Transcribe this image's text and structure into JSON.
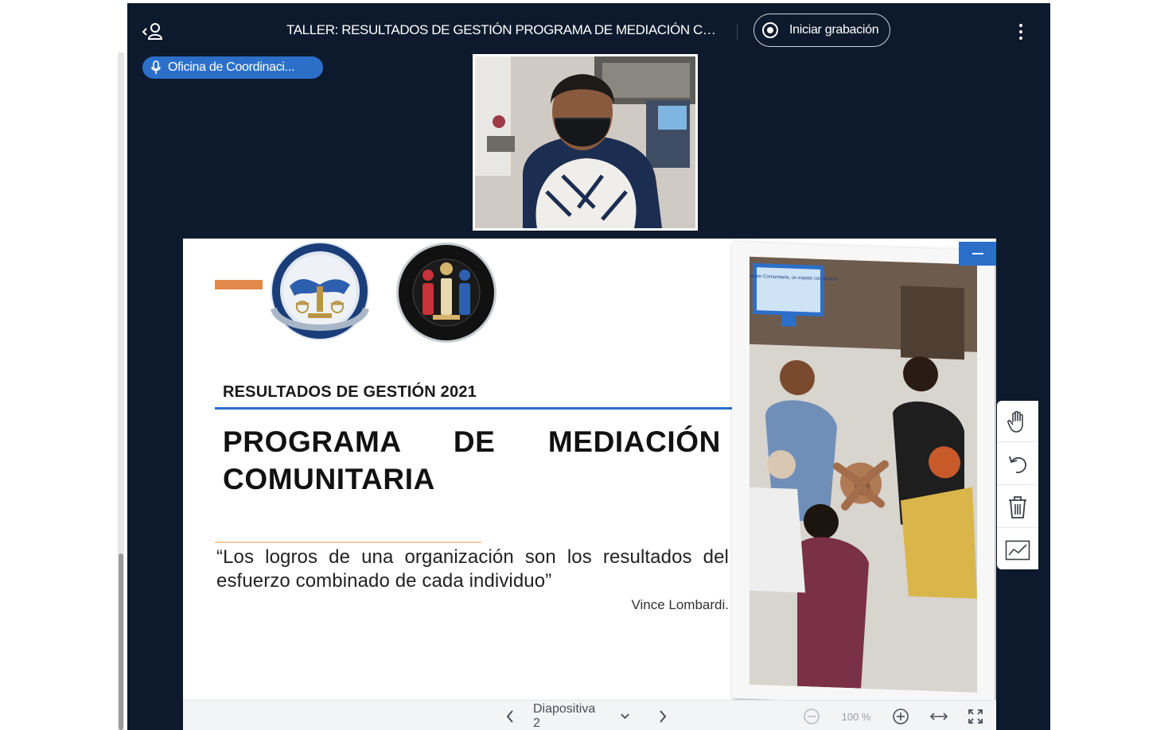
{
  "topbar": {
    "meeting_title": "TALLER: RESULTADOS DE GESTIÓN PROGRAMA DE MEDIACIÓN COMUNITA...",
    "record_label": "Iniciar grabación"
  },
  "talker": {
    "name": "Oficina de Coordinaci..."
  },
  "slide": {
    "subtitle": "RESULTADOS DE GESTIÓN 2021",
    "title": "PROGRAMA DE MEDIACIÓN COMUNITARIA",
    "quote": "“Los logros de una organización son los resultados del esfuerzo combinado de cada individuo”",
    "author": "Vince Lombardi.",
    "screen_text": "Mediación Comunitaria, un equipo con actitud"
  },
  "controls": {
    "slide_label": "Diapositiva 2",
    "zoom_level": "100 %"
  },
  "colors": {
    "app_background": "#0d1a2d",
    "accent_blue": "#2b6fc9",
    "orange": "#e2884a"
  },
  "icons": {
    "user_list": "user-list-icon",
    "record": "record-icon",
    "options": "more-vertical-icon",
    "microphone": "microphone-icon",
    "hand": "hand-icon",
    "undo": "undo-icon",
    "delete": "trash-icon",
    "chart": "line-chart-icon"
  }
}
